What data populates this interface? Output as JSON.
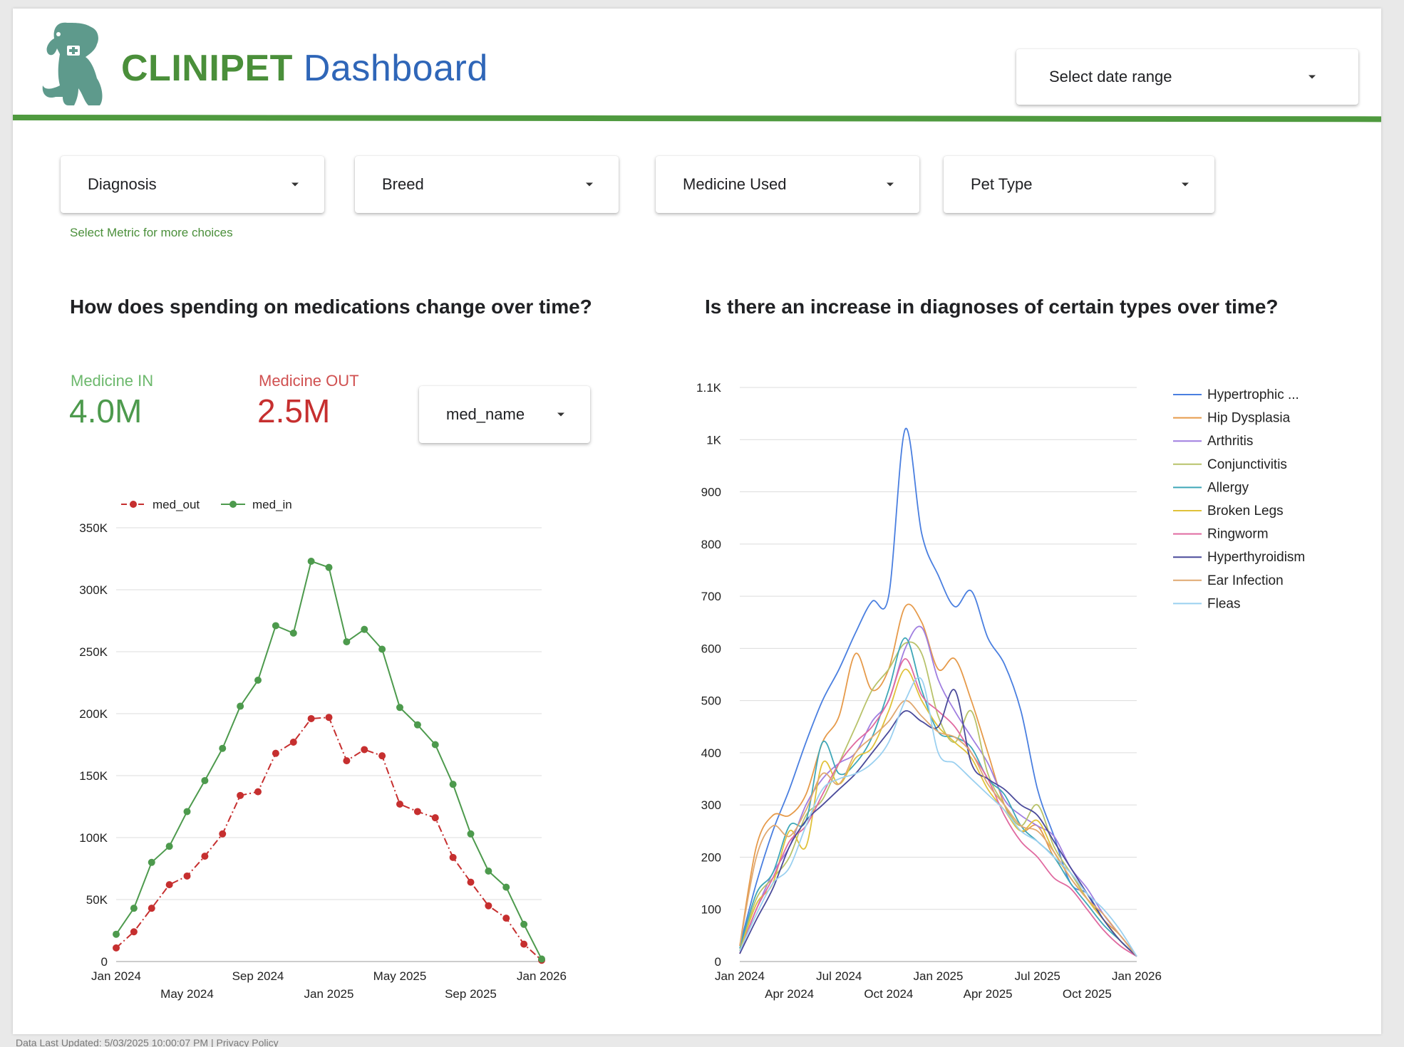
{
  "header": {
    "brand": "CLINIPET",
    "title": "Dashboard",
    "date_range_label": "Select date range"
  },
  "filters": {
    "diagnosis": "Diagnosis",
    "breed": "Breed",
    "medicine": "Medicine Used",
    "pet_type": "Pet Type",
    "hint": "Select Metric for more choices"
  },
  "left_panel": {
    "title": "How does spending on medications change over time?",
    "kpi_in_label": "Medicine IN",
    "kpi_in_value": "4.0M",
    "kpi_out_label": "Medicine OUT",
    "kpi_out_value": "2.5M",
    "selector_label": "med_name"
  },
  "right_panel": {
    "title": "Is there an increase in diagnoses of certain types over time?"
  },
  "footer": {
    "text": "Data Last Updated: 5/03/2025 10:00:07 PM  |  Privacy Policy"
  },
  "colors": {
    "brand_green": "#4a8f3a",
    "brand_blue": "#2f66b8",
    "kpi_in": "#5aaa5a",
    "kpi_out": "#c94040",
    "rule": "#4f9a3f"
  },
  "chart_data": [
    {
      "type": "line",
      "legend_position": "top-left",
      "grid": true,
      "x_ticks": [
        "Jan 2024",
        "May 2024",
        "Sep 2024",
        "Jan 2025",
        "May 2025",
        "Sep 2025",
        "Jan 2026"
      ],
      "x_range": [
        "2024-01",
        "2026-01"
      ],
      "y_ticks": [
        "0",
        "50K",
        "100K",
        "150K",
        "200K",
        "250K",
        "300K",
        "350K"
      ],
      "ylim": [
        0,
        350000
      ],
      "x": [
        "2024-01",
        "2024-02",
        "2024-03",
        "2024-04",
        "2024-05",
        "2024-06",
        "2024-07",
        "2024-08",
        "2024-09",
        "2024-10",
        "2024-11",
        "2024-12",
        "2025-01",
        "2025-02",
        "2025-03",
        "2025-04",
        "2025-05",
        "2025-06",
        "2025-07",
        "2025-08",
        "2025-09",
        "2025-10",
        "2025-11",
        "2025-12",
        "2026-01"
      ],
      "series": [
        {
          "name": "med_out",
          "color": "#c62f2f",
          "dashed": true,
          "values": [
            11000,
            24000,
            43000,
            62000,
            69000,
            85000,
            103000,
            134000,
            137000,
            168000,
            177000,
            196000,
            197000,
            162000,
            171000,
            166000,
            127000,
            121000,
            116000,
            84000,
            64000,
            45000,
            35000,
            14000,
            1000
          ]
        },
        {
          "name": "med_in",
          "color": "#4d9a4d",
          "dashed": false,
          "values": [
            22000,
            43000,
            80000,
            93000,
            121000,
            146000,
            172000,
            206000,
            227000,
            271000,
            265000,
            323000,
            318000,
            258000,
            268000,
            252000,
            205000,
            191000,
            175000,
            143000,
            103000,
            73000,
            60000,
            30000,
            2000
          ]
        }
      ]
    },
    {
      "type": "line",
      "smooth": true,
      "legend_position": "right",
      "grid": true,
      "x_ticks": [
        "Jan 2024",
        "Apr 2024",
        "Jul 2024",
        "Oct 2024",
        "Jan 2025",
        "Apr 2025",
        "Jul 2025",
        "Oct 2025",
        "Jan 2026"
      ],
      "x_range": [
        "2024-01",
        "2026-01"
      ],
      "y_ticks": [
        "0",
        "100",
        "200",
        "300",
        "400",
        "500",
        "600",
        "700",
        "800",
        "900",
        "1K",
        "1.1K"
      ],
      "ylim": [
        0,
        1100
      ],
      "x": [
        "2024-01",
        "2024-02",
        "2024-03",
        "2024-04",
        "2024-05",
        "2024-06",
        "2024-07",
        "2024-08",
        "2024-09",
        "2024-10",
        "2024-11",
        "2024-12",
        "2025-01",
        "2025-02",
        "2025-03",
        "2025-04",
        "2025-05",
        "2025-06",
        "2025-07",
        "2025-08",
        "2025-09",
        "2025-10",
        "2025-11",
        "2025-12",
        "2026-01"
      ],
      "series": [
        {
          "name": "Hypertrophic ...",
          "color": "#4a7fe0",
          "values": [
            30,
            150,
            250,
            330,
            420,
            500,
            560,
            630,
            690,
            700,
            1020,
            820,
            740,
            680,
            710,
            620,
            570,
            480,
            330,
            240,
            150,
            130,
            80,
            40,
            10
          ]
        },
        {
          "name": "Hip Dysplasia",
          "color": "#e69a4a",
          "values": [
            30,
            220,
            280,
            280,
            320,
            420,
            470,
            590,
            520,
            560,
            680,
            650,
            560,
            580,
            500,
            400,
            300,
            250,
            260,
            200,
            170,
            120,
            80,
            50,
            10
          ]
        },
        {
          "name": "Arthritis",
          "color": "#a07ee0",
          "values": [
            20,
            100,
            170,
            220,
            300,
            350,
            380,
            400,
            460,
            500,
            600,
            640,
            540,
            480,
            430,
            380,
            310,
            280,
            260,
            240,
            180,
            140,
            90,
            50,
            10
          ]
        },
        {
          "name": "Conjunctivitis",
          "color": "#b8c26a",
          "values": [
            20,
            120,
            160,
            200,
            280,
            310,
            380,
            450,
            520,
            560,
            610,
            590,
            470,
            420,
            480,
            360,
            300,
            260,
            300,
            220,
            170,
            120,
            80,
            40,
            10
          ]
        },
        {
          "name": "Allergy",
          "color": "#3fa7b8",
          "values": [
            25,
            130,
            170,
            260,
            270,
            420,
            360,
            380,
            430,
            520,
            620,
            520,
            440,
            430,
            410,
            350,
            320,
            260,
            230,
            200,
            150,
            110,
            70,
            40,
            10
          ]
        },
        {
          "name": "Broken Legs",
          "color": "#e0c23a",
          "values": [
            20,
            110,
            150,
            250,
            220,
            380,
            340,
            390,
            410,
            480,
            560,
            500,
            450,
            420,
            390,
            330,
            290,
            250,
            270,
            210,
            160,
            120,
            80,
            40,
            10
          ]
        },
        {
          "name": "Ringworm",
          "color": "#e06aa0",
          "values": [
            15,
            100,
            160,
            230,
            260,
            320,
            380,
            420,
            450,
            500,
            580,
            510,
            480,
            450,
            400,
            350,
            280,
            230,
            200,
            160,
            140,
            100,
            60,
            30,
            10
          ]
        },
        {
          "name": "Hyperthyroidism",
          "color": "#4a4a9a",
          "values": [
            15,
            80,
            140,
            220,
            270,
            300,
            330,
            360,
            400,
            440,
            480,
            460,
            450,
            520,
            380,
            350,
            330,
            300,
            280,
            230,
            180,
            130,
            80,
            40,
            10
          ]
        },
        {
          "name": "Ear Infection",
          "color": "#e0a870",
          "values": [
            30,
            200,
            260,
            240,
            290,
            360,
            340,
            400,
            430,
            460,
            500,
            470,
            440,
            430,
            400,
            340,
            300,
            260,
            250,
            210,
            160,
            120,
            90,
            50,
            10
          ]
        },
        {
          "name": "Fleas",
          "color": "#9ad0f0",
          "values": [
            20,
            90,
            150,
            180,
            260,
            330,
            350,
            360,
            380,
            420,
            500,
            540,
            400,
            380,
            350,
            320,
            290,
            250,
            230,
            200,
            170,
            130,
            100,
            60,
            10
          ]
        }
      ]
    }
  ]
}
